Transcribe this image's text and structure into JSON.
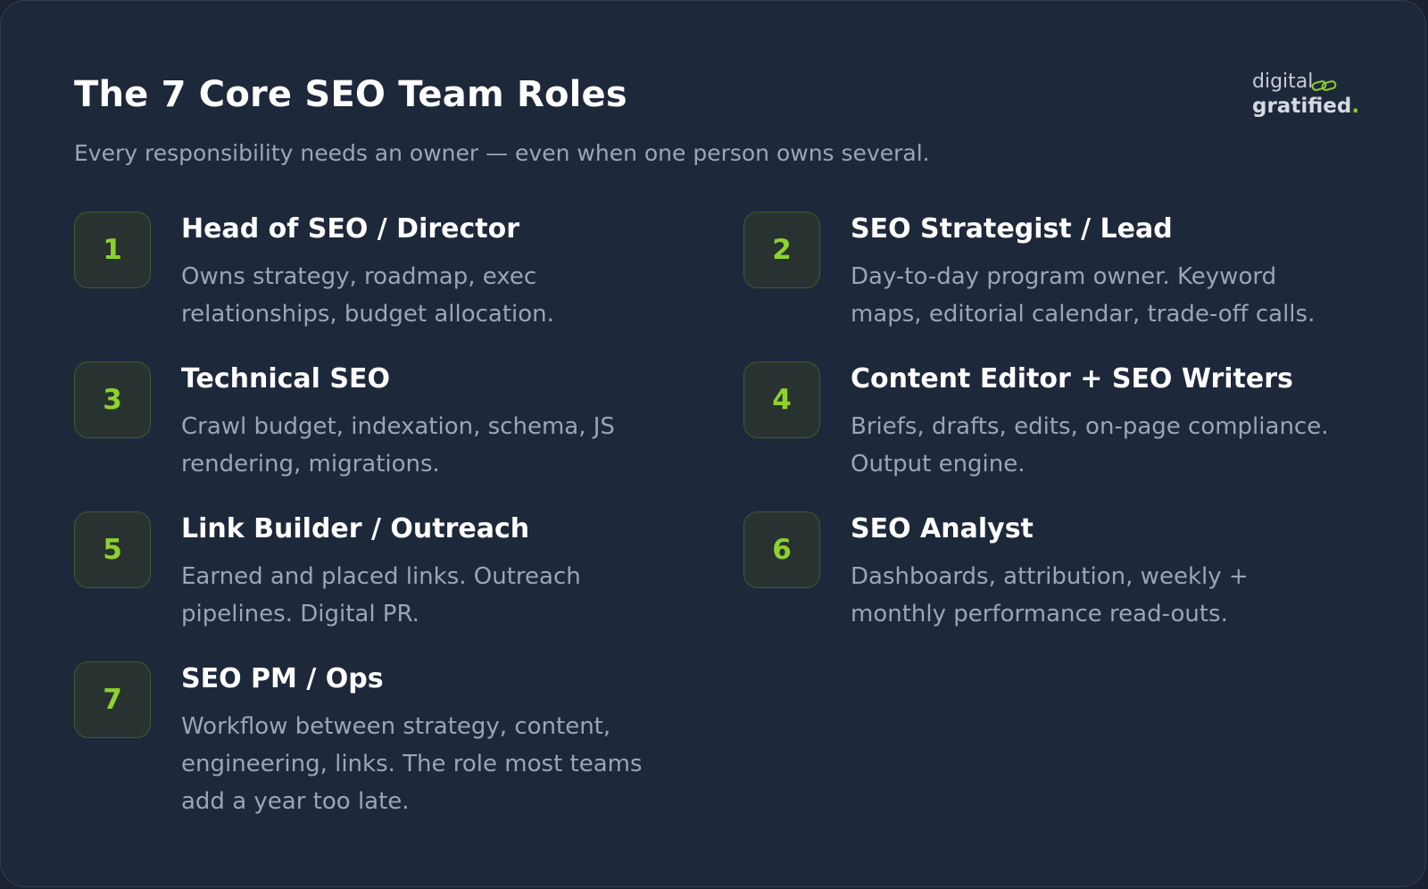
{
  "header": {
    "title": "The 7 Core SEO Team Roles",
    "subtitle": "Every responsibility needs an owner — even when one person owns several."
  },
  "logo": {
    "line1": "digital",
    "line2": "gratified",
    "dot": ".",
    "icon": "chain-link-icon",
    "accent_color": "#8fcf2a"
  },
  "colors": {
    "background": "#1e283b",
    "badge_number": "#8fd12d",
    "title": "#ffffff",
    "body_text": "#9aa5b6"
  },
  "roles": [
    {
      "number": "1",
      "title": "Head of SEO / Director",
      "description": "Owns strategy, roadmap, exec relationships, budget allocation."
    },
    {
      "number": "2",
      "title": "SEO Strategist / Lead",
      "description": "Day-to-day program owner. Keyword maps, editorial calendar, trade-off calls."
    },
    {
      "number": "3",
      "title": "Technical SEO",
      "description": "Crawl budget, indexation, schema, JS rendering, migrations."
    },
    {
      "number": "4",
      "title": "Content Editor + SEO Writers",
      "description": "Briefs, drafts, edits, on-page compliance. Output engine."
    },
    {
      "number": "5",
      "title": "Link Builder / Outreach",
      "description": "Earned and placed links. Outreach pipelines. Digital PR."
    },
    {
      "number": "6",
      "title": "SEO Analyst",
      "description": "Dashboards, attribution, weekly + monthly performance read-outs."
    },
    {
      "number": "7",
      "title": "SEO PM / Ops",
      "description": "Workflow between strategy, content, engineering, links. The role most teams add a year too late."
    }
  ]
}
